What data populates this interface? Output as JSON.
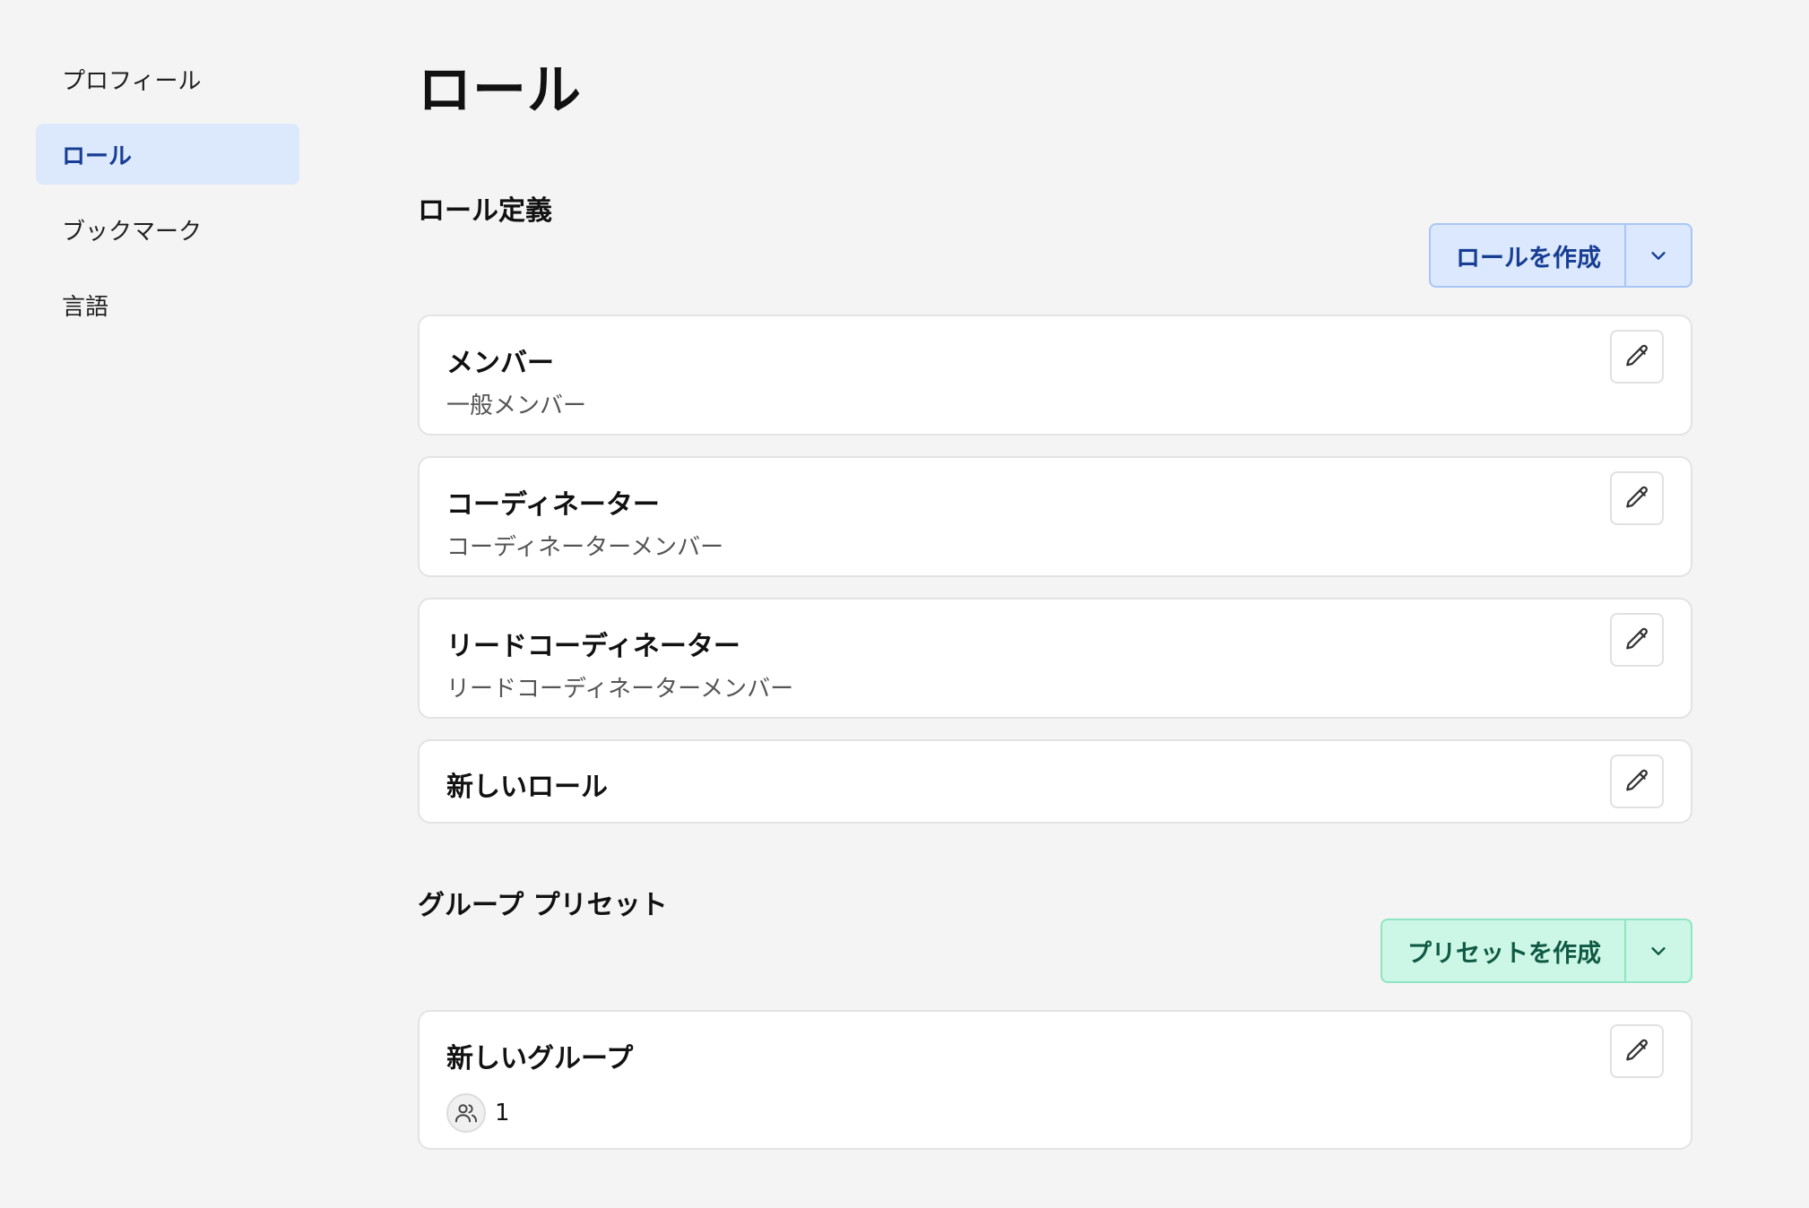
{
  "sidebar": {
    "items": [
      {
        "label": "プロフィール",
        "active": false
      },
      {
        "label": "ロール",
        "active": true
      },
      {
        "label": "ブックマーク",
        "active": false
      },
      {
        "label": "言語",
        "active": false
      }
    ]
  },
  "page": {
    "title": "ロール"
  },
  "roles_section": {
    "title": "ロール定義",
    "create_label": "ロールを作成",
    "roles": [
      {
        "name": "メンバー",
        "description": "一般メンバー"
      },
      {
        "name": "コーディネーター",
        "description": "コーディネーターメンバー"
      },
      {
        "name": "リードコーディネーター",
        "description": "リードコーディネーターメンバー"
      },
      {
        "name": "新しいロール",
        "description": ""
      }
    ]
  },
  "presets_section": {
    "title": "グループ プリセット",
    "create_label": "プリセットを作成",
    "groups": [
      {
        "name": "新しいグループ",
        "member_count": "1"
      }
    ]
  },
  "colors": {
    "active_nav_bg": "#dce9fd",
    "active_nav_text": "#173e93",
    "blue_button_bg": "#dbe8fd",
    "green_button_bg": "#ccf6e5"
  },
  "icons": {
    "edit": "pencil-icon",
    "dropdown": "chevron-down-icon",
    "members": "users-icon"
  }
}
